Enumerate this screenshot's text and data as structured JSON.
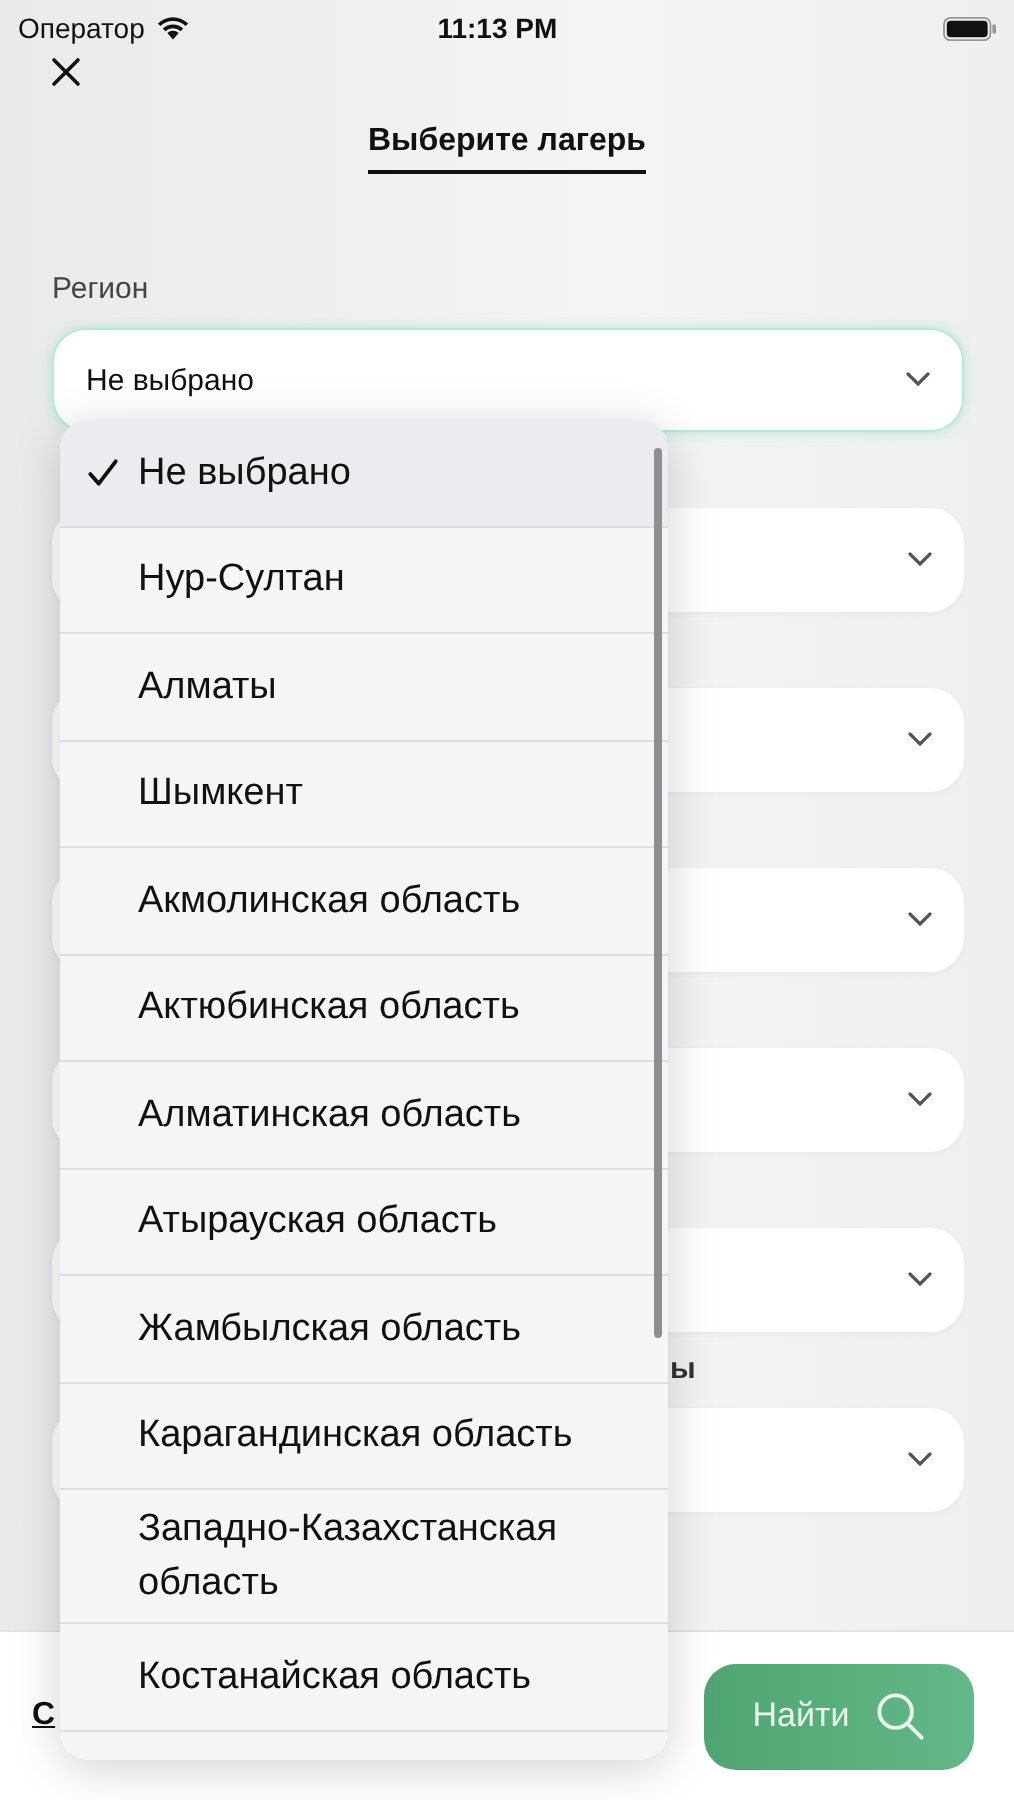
{
  "status_bar": {
    "carrier": "Оператор",
    "time": "11:13 PM"
  },
  "title": "Выберите лагерь",
  "fields": [
    {
      "label": "Регион",
      "value": "Не выбрано",
      "focused": true
    },
    {
      "focused": false
    },
    {
      "focused": false
    },
    {
      "focused": false
    },
    {
      "focused": false
    },
    {
      "focused": false
    },
    {
      "label_tail": "ы",
      "focused": false
    }
  ],
  "dropdown": {
    "options": [
      {
        "label": "Не выбрано",
        "selected": true
      },
      {
        "label": "Нур-Султан",
        "selected": false
      },
      {
        "label": "Алматы",
        "selected": false
      },
      {
        "label": "Шымкент",
        "selected": false
      },
      {
        "label": "Акмолинская область",
        "selected": false
      },
      {
        "label": "Актюбинская область",
        "selected": false
      },
      {
        "label": "Алматинская область",
        "selected": false
      },
      {
        "label": "Атырауская область",
        "selected": false
      },
      {
        "label": "Жамбылская область",
        "selected": false
      },
      {
        "label": "Карагандинская область",
        "selected": false
      },
      {
        "label": "Западно-Казахстанская область",
        "selected": false
      },
      {
        "label": "Костанайская область",
        "selected": false
      }
    ]
  },
  "footer": {
    "link": "С",
    "search_button": "Найти"
  }
}
